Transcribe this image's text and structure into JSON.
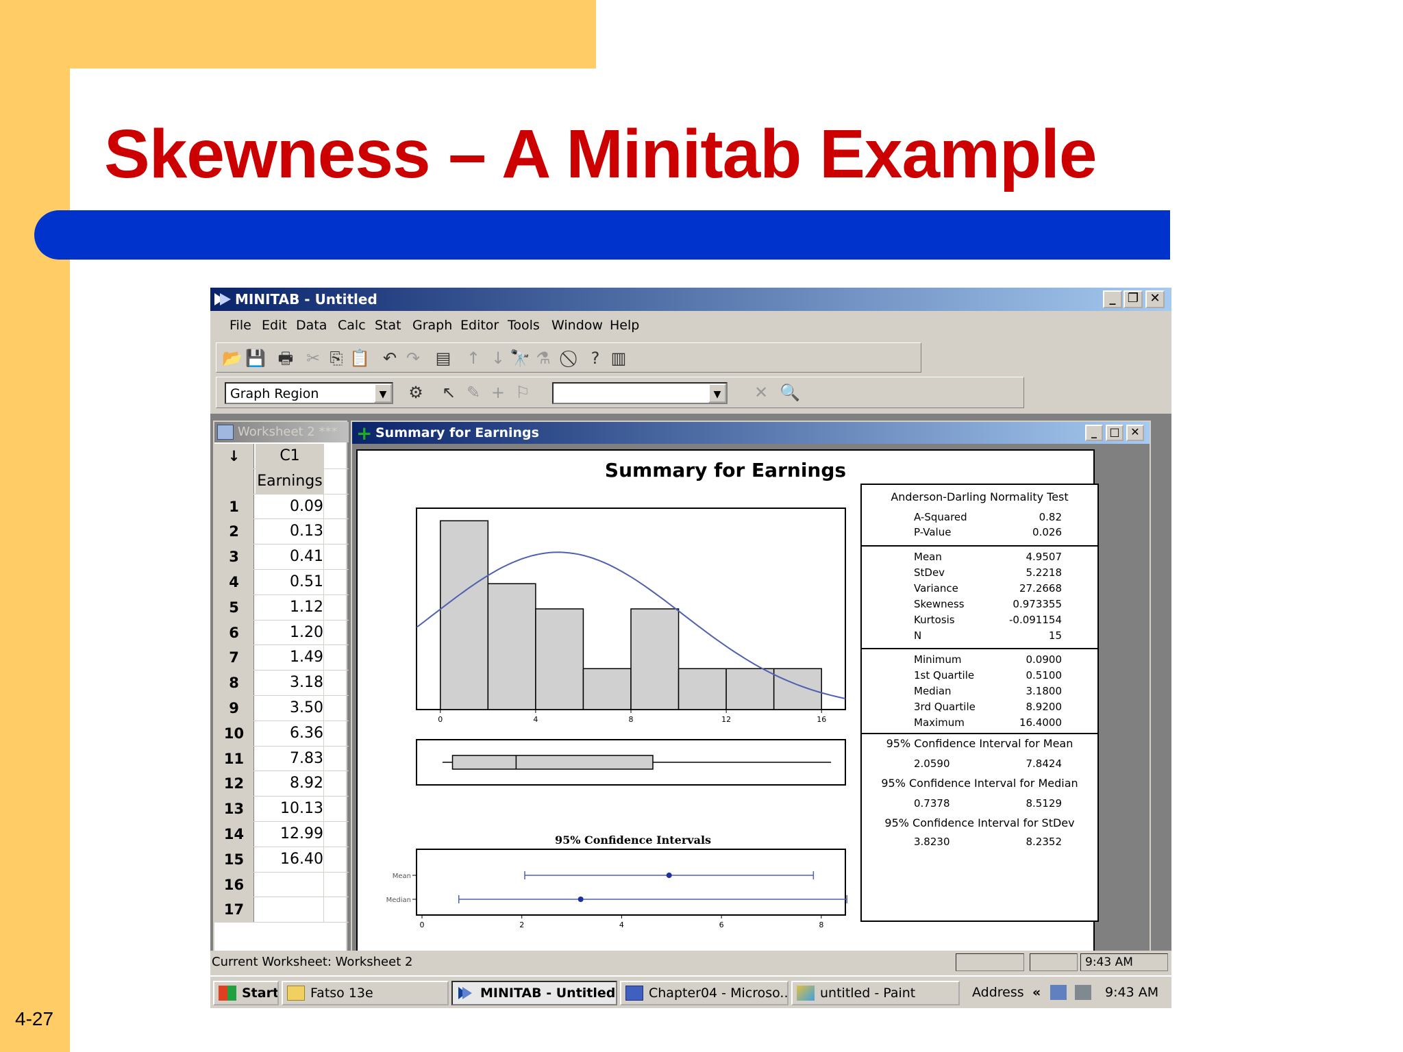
{
  "slide": {
    "title": "Skewness – A Minitab Example",
    "number": "4-27"
  },
  "app": {
    "title": "MINITAB - Untitled",
    "menu": [
      "File",
      "Edit",
      "Data",
      "Calc",
      "Stat",
      "Graph",
      "Editor",
      "Tools",
      "Window",
      "Help"
    ],
    "graph_region_combo": "Graph Region",
    "second_combo": ""
  },
  "worksheet": {
    "title": "Worksheet 2 ***",
    "col_id": "C1",
    "col_name": "Earnings",
    "corner_label": "↓",
    "rows": [
      {
        "n": "1",
        "v": "0.09"
      },
      {
        "n": "2",
        "v": "0.13"
      },
      {
        "n": "3",
        "v": "0.41"
      },
      {
        "n": "4",
        "v": "0.51"
      },
      {
        "n": "5",
        "v": "1.12"
      },
      {
        "n": "6",
        "v": "1.20"
      },
      {
        "n": "7",
        "v": "1.49"
      },
      {
        "n": "8",
        "v": "3.18"
      },
      {
        "n": "9",
        "v": "3.50"
      },
      {
        "n": "10",
        "v": "6.36"
      },
      {
        "n": "11",
        "v": "7.83"
      },
      {
        "n": "12",
        "v": "8.92"
      },
      {
        "n": "13",
        "v": "10.13"
      },
      {
        "n": "14",
        "v": "12.99"
      },
      {
        "n": "15",
        "v": "16.40"
      },
      {
        "n": "16",
        "v": ""
      },
      {
        "n": "17",
        "v": ""
      }
    ]
  },
  "graph_window": {
    "title": "Summary for Earnings",
    "graph_title": "Summary for Earnings",
    "ci_title": "95% Confidence Intervals",
    "ci_labels": [
      "Mean",
      "Median"
    ],
    "histogram_ticks": [
      "0",
      "4",
      "8",
      "12",
      "16"
    ],
    "ci_ticks": [
      "0",
      "2",
      "4",
      "6",
      "8"
    ]
  },
  "stats": {
    "ad_title": "Anderson-Darling Normality Test",
    "ad_rows": [
      [
        "A-Squared",
        "0.82"
      ],
      [
        "P-Value",
        "0.026"
      ]
    ],
    "moments": [
      [
        "Mean",
        "4.9507"
      ],
      [
        "StDev",
        "5.2218"
      ],
      [
        "Variance",
        "27.2668"
      ],
      [
        "Skewness",
        "0.973355"
      ],
      [
        "Kurtosis",
        "-0.091154"
      ],
      [
        "N",
        "15"
      ]
    ],
    "quartiles": [
      [
        "Minimum",
        "0.0900"
      ],
      [
        "1st Quartile",
        "0.5100"
      ],
      [
        "Median",
        "3.1800"
      ],
      [
        "3rd Quartile",
        "8.9200"
      ],
      [
        "Maximum",
        "16.4000"
      ]
    ],
    "ci_mean_title": "95% Confidence Interval for Mean",
    "ci_mean": [
      "2.0590",
      "7.8424"
    ],
    "ci_median_title": "95% Confidence Interval for Median",
    "ci_median": [
      "0.7378",
      "8.5129"
    ],
    "ci_stdev_title": "95% Confidence Interval for StDev",
    "ci_stdev": [
      "3.8230",
      "8.2352"
    ]
  },
  "chart_data": [
    {
      "type": "bar",
      "title": "",
      "x": [
        1,
        3,
        5,
        7,
        9,
        11,
        13,
        15
      ],
      "values": [
        3,
        2,
        1.6,
        0.65,
        1.6,
        0.65,
        0.65,
        0.65
      ],
      "xlim": [
        -1,
        17
      ],
      "xticks": [
        0,
        4,
        8,
        12,
        16
      ],
      "bin_width": 2
    },
    {
      "type": "box",
      "min": 0.09,
      "q1": 0.51,
      "median": 3.18,
      "q3": 8.92,
      "max": 16.4
    },
    {
      "type": "scatter",
      "title": "95% Confidence Intervals",
      "series": [
        {
          "name": "Mean",
          "point": 4.9507,
          "low": 2.059,
          "high": 7.8424
        },
        {
          "name": "Median",
          "point": 3.18,
          "low": 0.7378,
          "high": 8.5129
        }
      ],
      "xlim": [
        0,
        8.4
      ]
    }
  ],
  "status": {
    "text": "Current Worksheet: Worksheet 2",
    "time": "9:43 AM"
  },
  "taskbar": {
    "start": "Start",
    "items": [
      "Fatso 13e",
      "MINITAB - Untitled",
      "Chapter04 - Microso...",
      "untitled - Paint"
    ],
    "address": "Address",
    "chevron": "«",
    "time": "9:43 AM"
  },
  "colors": {
    "title_red": "#cc0000",
    "band_blue": "#0033cc",
    "side_yellow": "#ffcc66",
    "curve_blue": "#5060b0"
  }
}
